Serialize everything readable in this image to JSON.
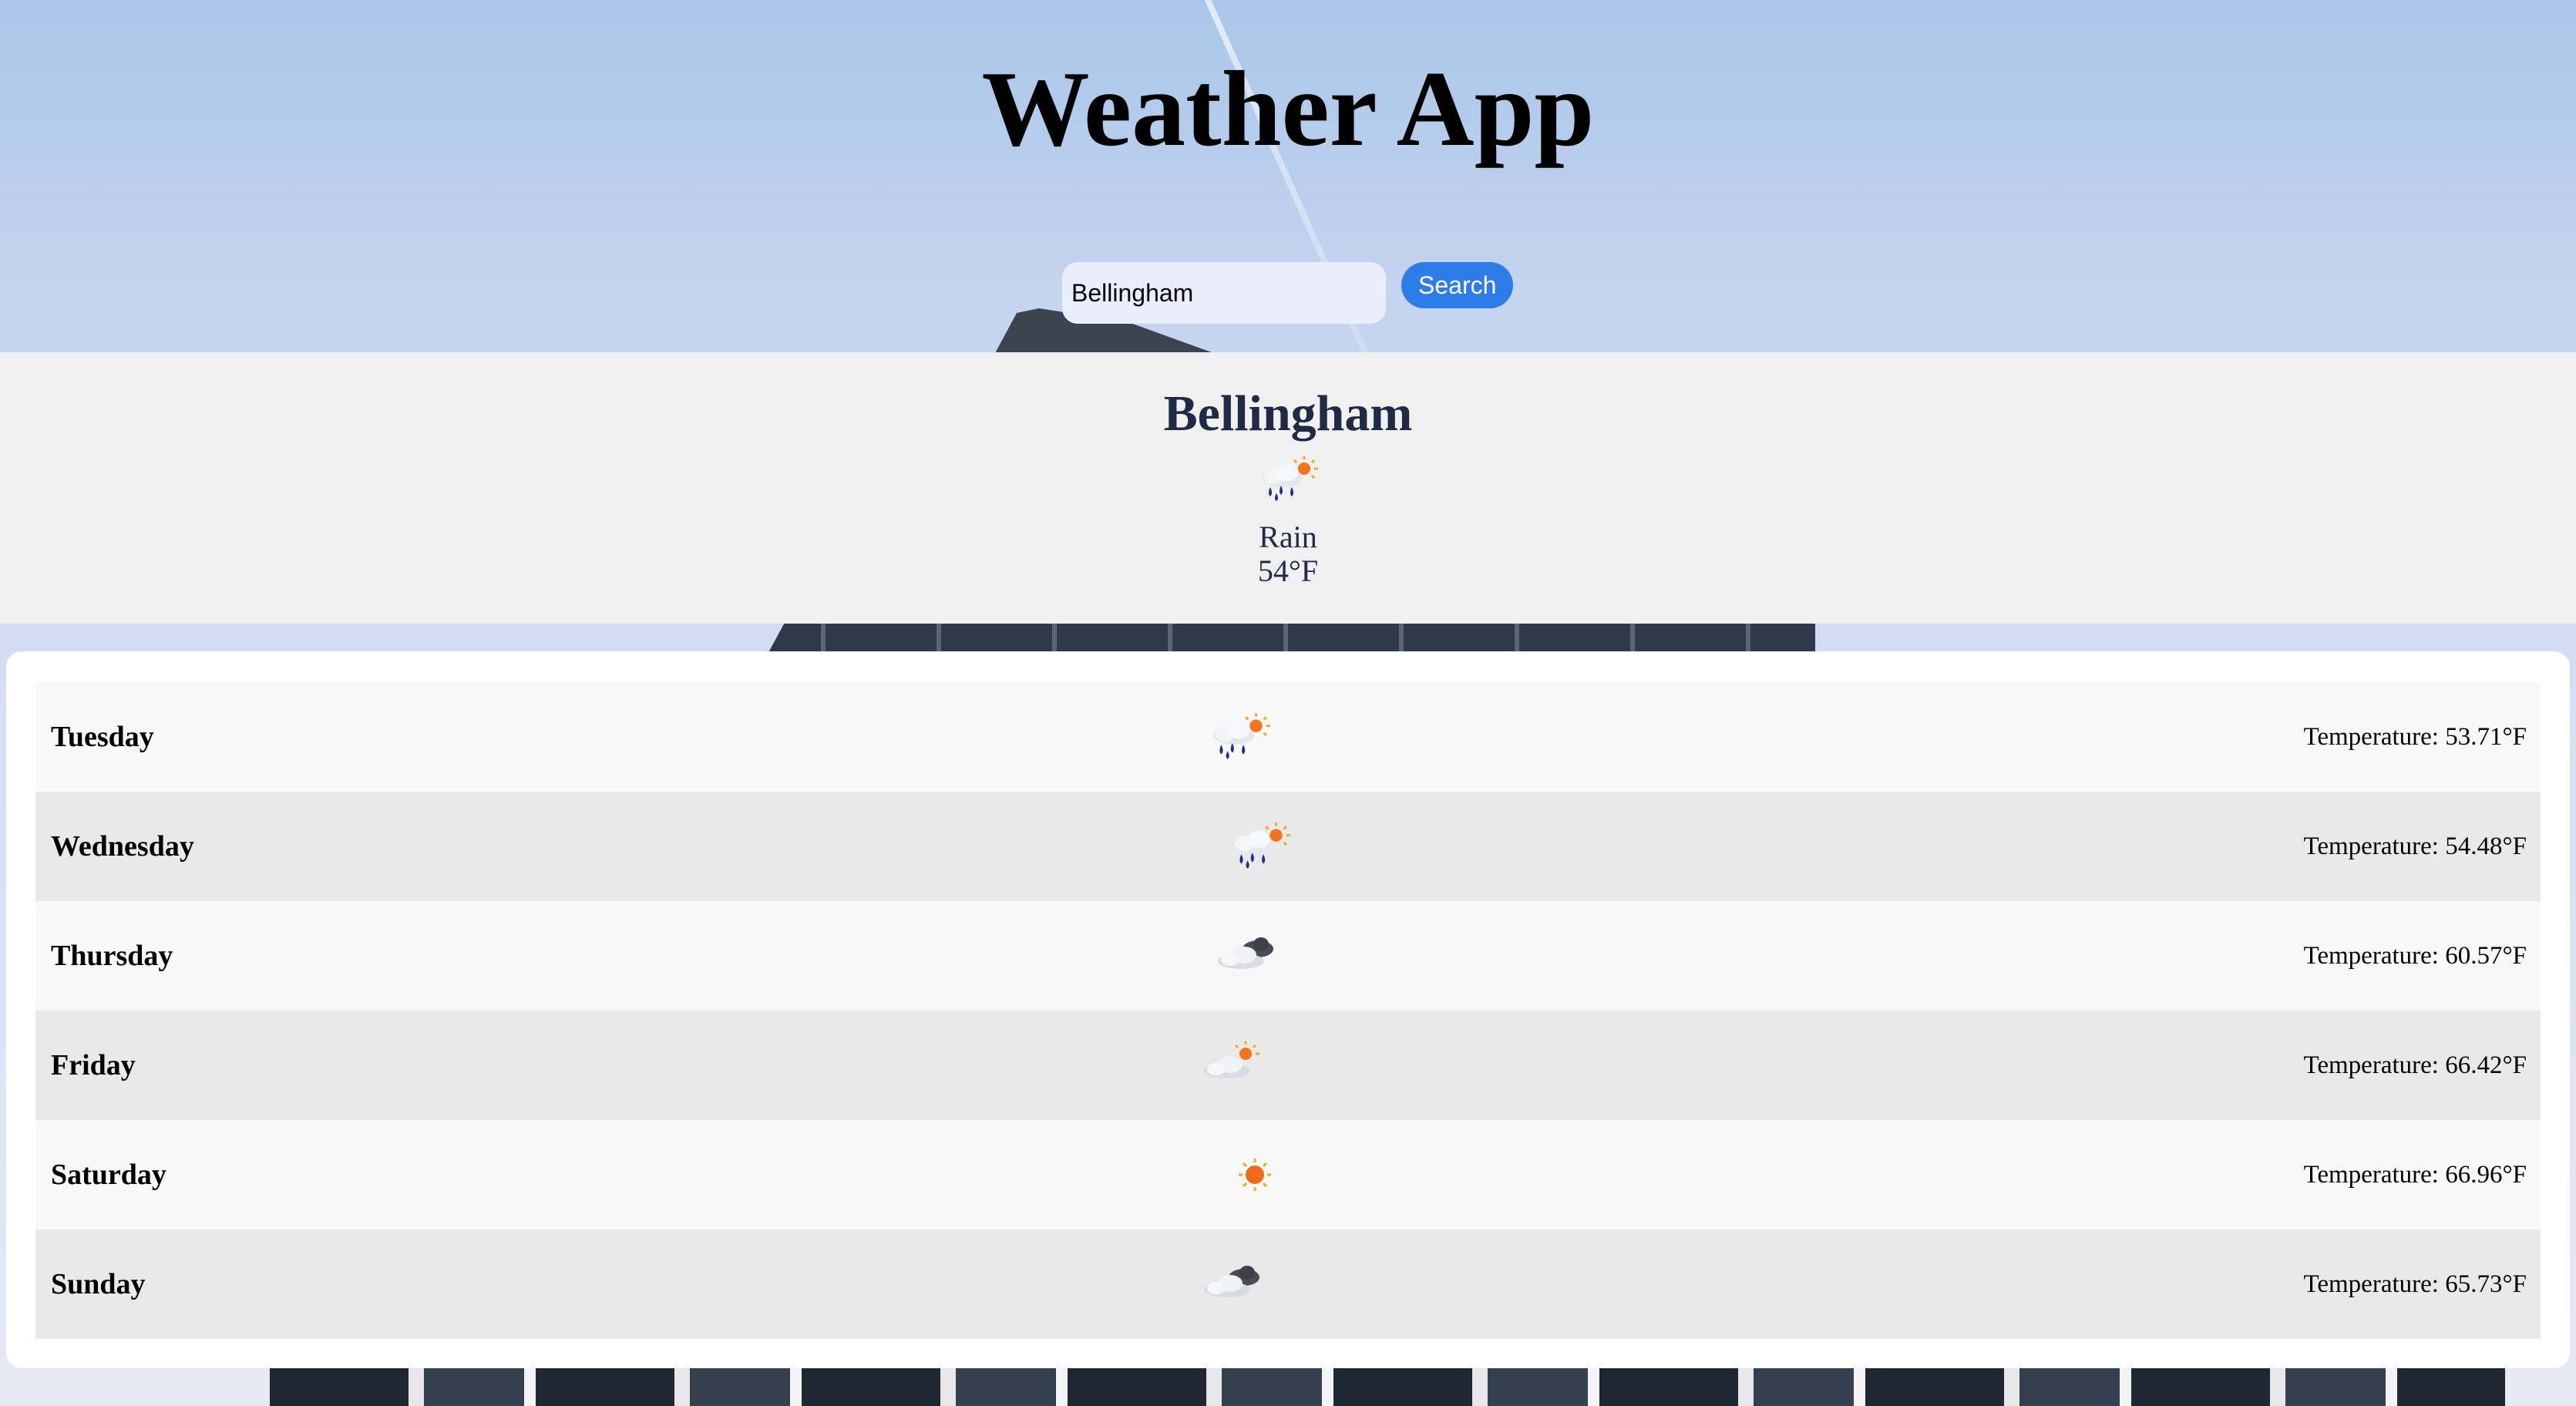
{
  "header": {
    "title": "Weather App"
  },
  "search": {
    "value": "Bellingham",
    "button_label": "Search"
  },
  "current": {
    "city": "Bellingham",
    "icon": "rain-cloud-sun-icon",
    "description": "Rain",
    "temperature": "54°F"
  },
  "forecast": {
    "days": [
      {
        "day": "Tuesday",
        "icon": "rain-cloud-sun-icon",
        "temperature": "Temperature: 53.71°F"
      },
      {
        "day": "Wednesday",
        "icon": "rain-cloud-sun-icon",
        "temperature": "Temperature: 54.48°F"
      },
      {
        "day": "Thursday",
        "icon": "clouds-icon",
        "temperature": "Temperature: 60.57°F"
      },
      {
        "day": "Friday",
        "icon": "cloud-sun-icon",
        "temperature": "Temperature: 66.42°F"
      },
      {
        "day": "Saturday",
        "icon": "sun-icon",
        "temperature": "Temperature: 66.96°F"
      },
      {
        "day": "Sunday",
        "icon": "clouds-icon",
        "temperature": "Temperature: 65.73°F"
      }
    ]
  }
}
